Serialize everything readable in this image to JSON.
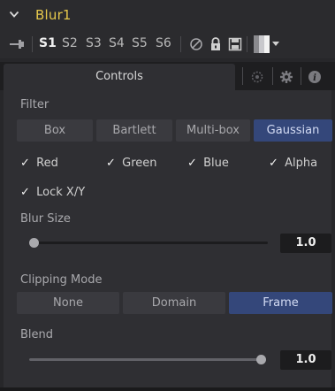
{
  "node": {
    "title": "Blur1"
  },
  "toolbar": {
    "slots": [
      "S1",
      "S2",
      "S3",
      "S4",
      "S5",
      "S6"
    ],
    "active_slot": "S1",
    "icons": [
      "pin-icon",
      "disable-icon",
      "lock-icon",
      "save-icon",
      "color-swatch-icon",
      "dropdown-icon"
    ]
  },
  "tabs": {
    "active_label": "Controls",
    "icons": [
      "modifiers-icon",
      "settings-gear-icon",
      "info-icon"
    ]
  },
  "filter": {
    "label": "Filter",
    "options": [
      "Box",
      "Bartlett",
      "Multi-box",
      "Gaussian"
    ],
    "selected": "Gaussian"
  },
  "channels": {
    "red": {
      "label": "Red",
      "checked": true
    },
    "green": {
      "label": "Green",
      "checked": true
    },
    "blue": {
      "label": "Blue",
      "checked": true
    },
    "alpha": {
      "label": "Alpha",
      "checked": true
    }
  },
  "lock_xy": {
    "label": "Lock X/Y",
    "checked": true
  },
  "blur_size": {
    "label": "Blur Size",
    "value": "1.0",
    "fraction": 0.0
  },
  "clipping": {
    "label": "Clipping Mode",
    "options": [
      "None",
      "Domain",
      "Frame"
    ],
    "selected": "Frame"
  },
  "blend": {
    "label": "Blend",
    "value": "1.0",
    "fraction": 1.0
  },
  "colors": {
    "title": "#e6c84c",
    "selected_button": "#34477a",
    "panel": "#2f2f33"
  }
}
